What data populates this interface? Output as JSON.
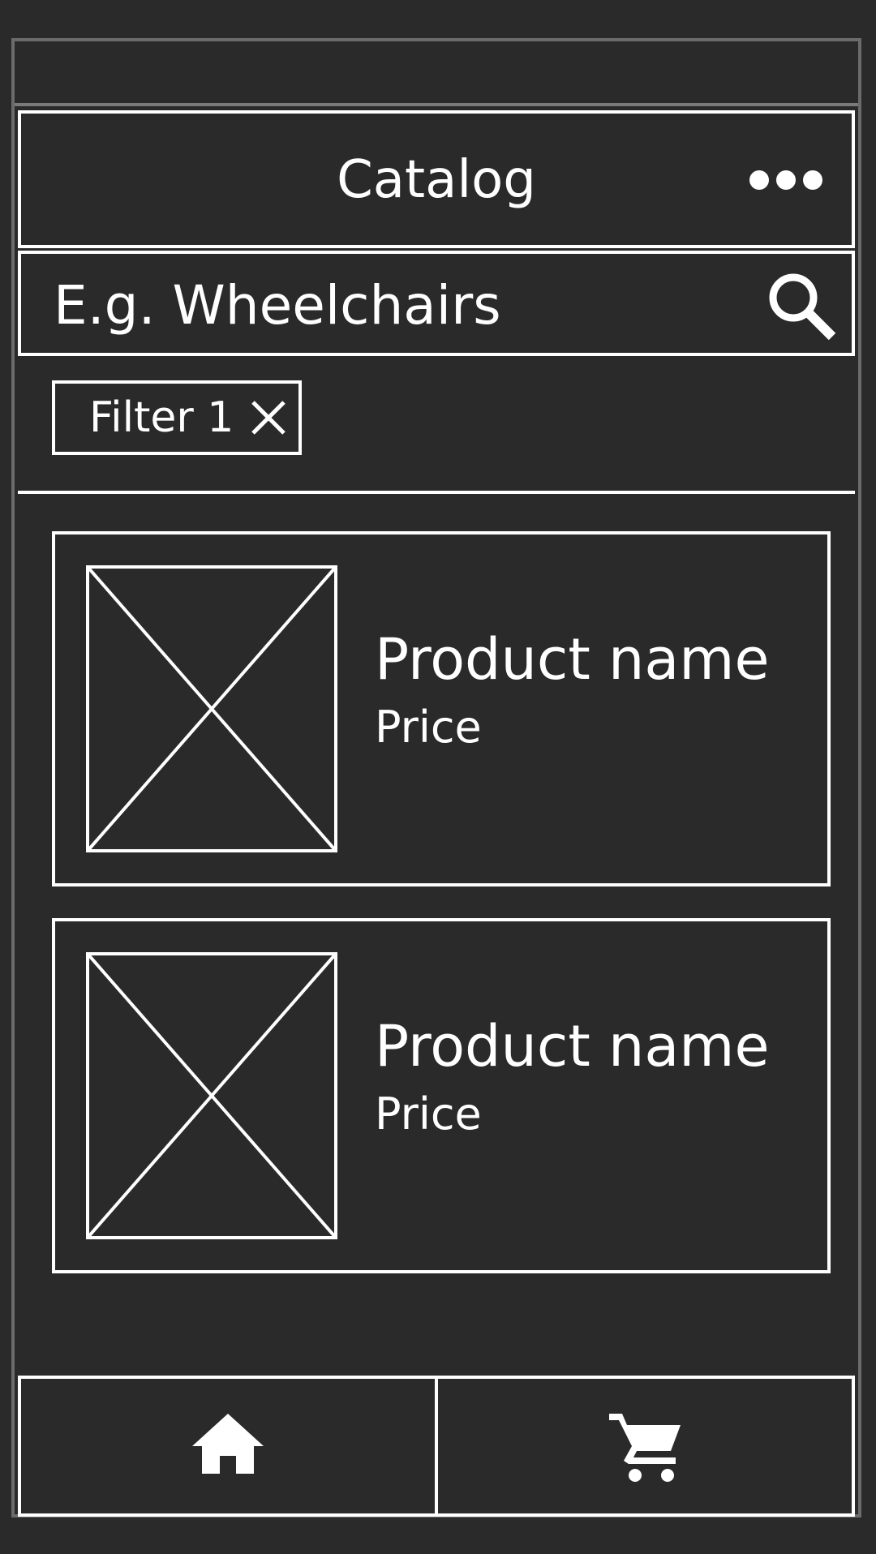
{
  "header": {
    "title": "Catalog",
    "more_icon": "more-horizontal-icon"
  },
  "search": {
    "placeholder": "E.g. Wheelchairs",
    "value": "",
    "icon": "search-icon"
  },
  "filters": [
    {
      "label": "Filter 1",
      "remove_icon": "close-icon"
    }
  ],
  "products": [
    {
      "name": "Product name",
      "price": "Price",
      "image_icon": "image-placeholder-icon"
    },
    {
      "name": "Product name",
      "price": "Price",
      "image_icon": "image-placeholder-icon"
    }
  ],
  "bottom_nav": [
    {
      "icon": "home-icon"
    },
    {
      "icon": "cart-icon"
    }
  ],
  "colors": {
    "background": "#2a2a2a",
    "foreground": "#ffffff",
    "frame_border": "#6b6b6b"
  }
}
